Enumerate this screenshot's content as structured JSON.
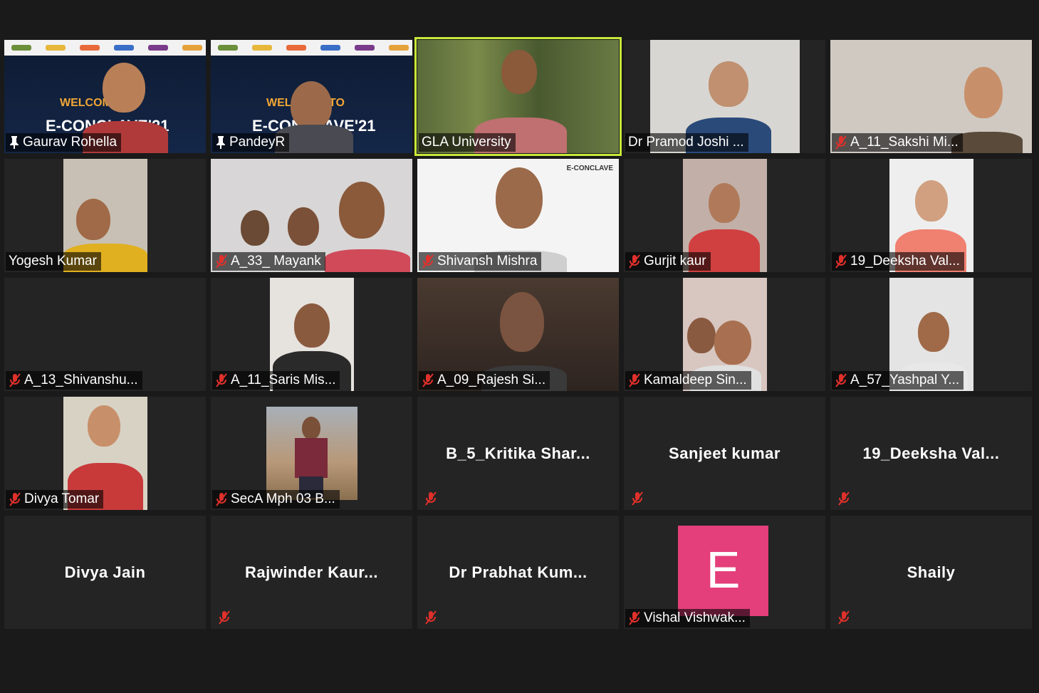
{
  "banner_brand": {
    "welcome": "WELCOME TO",
    "conclave": "E-CONCLAVE'21",
    "conclave_small": "E-CONCLAVE"
  },
  "avatar_letter": "E",
  "colors": {
    "background": "#1a1a1a",
    "tile": "#242424",
    "active_speaker_border": "#c8e83a",
    "avatar_e": "#e43f7a",
    "mute_icon": "#e0302b"
  },
  "participants": [
    {
      "name": "Gaurav Rohella",
      "pinned": true,
      "muted": false,
      "video": true
    },
    {
      "name": "PandeyR",
      "pinned": true,
      "muted": false,
      "video": true
    },
    {
      "name": "GLA University",
      "pinned": false,
      "muted": false,
      "video": true,
      "active_speaker": true
    },
    {
      "name": "Dr Pramod Joshi ...",
      "pinned": false,
      "muted": false,
      "video": true
    },
    {
      "name": "A_11_Sakshi Mi...",
      "pinned": false,
      "muted": true,
      "video": true
    },
    {
      "name": "Yogesh Kumar",
      "pinned": false,
      "muted": false,
      "video": true
    },
    {
      "name": "A_33_ Mayank",
      "pinned": false,
      "muted": true,
      "video": true
    },
    {
      "name": "Shivansh Mishra",
      "pinned": false,
      "muted": true,
      "video": true
    },
    {
      "name": "Gurjit kaur",
      "pinned": false,
      "muted": true,
      "video": true
    },
    {
      "name": "19_Deeksha Val...",
      "pinned": false,
      "muted": true,
      "video": true
    },
    {
      "name": "A_13_Shivanshu...",
      "pinned": false,
      "muted": true,
      "video": false
    },
    {
      "name": "A_11_Saris Mis...",
      "pinned": false,
      "muted": true,
      "video": true
    },
    {
      "name": "A_09_Rajesh Si...",
      "pinned": false,
      "muted": true,
      "video": true
    },
    {
      "name": "Kamaldeep Sin...",
      "pinned": false,
      "muted": true,
      "video": true
    },
    {
      "name": "A_57_Yashpal Y...",
      "pinned": false,
      "muted": true,
      "video": true
    },
    {
      "name": "Divya Tomar",
      "pinned": false,
      "muted": true,
      "video": true
    },
    {
      "name": "SecA Mph 03 B...",
      "pinned": false,
      "muted": true,
      "video": true
    },
    {
      "name": "B_5_Kritika  Shar...",
      "pinned": false,
      "muted": true,
      "video": false
    },
    {
      "name": "Sanjeet kumar",
      "pinned": false,
      "muted": true,
      "video": false
    },
    {
      "name": "19_Deeksha  Val...",
      "pinned": false,
      "muted": true,
      "video": false
    },
    {
      "name": "Divya Jain",
      "pinned": false,
      "muted": false,
      "video": false
    },
    {
      "name": "Rajwinder  Kaur...",
      "pinned": false,
      "muted": true,
      "video": false
    },
    {
      "name": "Dr  Prabhat  Kum...",
      "pinned": false,
      "muted": true,
      "video": false
    },
    {
      "name": "Vishal Vishwak...",
      "pinned": false,
      "muted": true,
      "video": false,
      "avatar": true
    },
    {
      "name": "Shaily",
      "pinned": false,
      "muted": true,
      "video": false
    }
  ]
}
